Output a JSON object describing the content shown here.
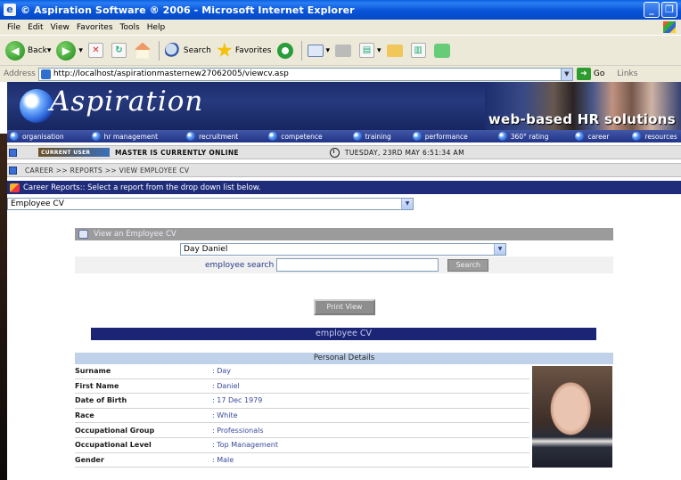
{
  "window": {
    "title": "© Aspiration Software ® 2006 - Microsoft Internet Explorer"
  },
  "menu": [
    "File",
    "Edit",
    "View",
    "Favorites",
    "Tools",
    "Help"
  ],
  "toolbar": {
    "back": "Back",
    "search": "Search",
    "favorites": "Favorites"
  },
  "address": {
    "label": "Address",
    "url": "http://localhost/aspirationmasternew27062005/viewcv.asp",
    "go": "Go",
    "links": "Links"
  },
  "header": {
    "logo": "Aspiration",
    "tagline": "web-based HR solutions"
  },
  "nav": [
    "organisation",
    "hr management",
    "recruitment",
    "competence",
    "training",
    "performance",
    "360° rating",
    "career",
    "resources"
  ],
  "status": {
    "badge": "CURRENT USER",
    "online": "MASTER IS CURRENTLY ONLINE",
    "datetime": "TUESDAY, 23RD MAY 6:51:34 AM"
  },
  "breadcrumb": "CAREER >> REPORTS >> VIEW EMPLOYEE CV",
  "reports": {
    "heading": "Career Reports:: Select a report from the drop down list below.",
    "selected": "Employee CV"
  },
  "view_cv": {
    "heading": "View an Employee CV",
    "employee": "Day Daniel",
    "search_label": "employee search",
    "search_value": "",
    "search_button": "Search"
  },
  "print_button": "Print View",
  "cv_title": "employee CV",
  "personal": {
    "heading": "Personal Details",
    "rows": [
      {
        "label": "Surname",
        "value": ": Day"
      },
      {
        "label": "First Name",
        "value": ": Daniel"
      },
      {
        "label": "Date of Birth",
        "value": ": 17 Dec 1979"
      },
      {
        "label": "Race",
        "value": ": White"
      },
      {
        "label": "Occupational Group",
        "value": ": Professionals"
      },
      {
        "label": "Occupational Level",
        "value": ": Top Management"
      },
      {
        "label": "Gender",
        "value": ": Male"
      }
    ]
  },
  "colors": {
    "titlebar": "#0854d8",
    "header": "#1d2e6e",
    "nav": "#213489",
    "reports_bar": "#1e2c7a",
    "cv_bar": "#1c2575",
    "value_text": "#3a4a9c"
  }
}
